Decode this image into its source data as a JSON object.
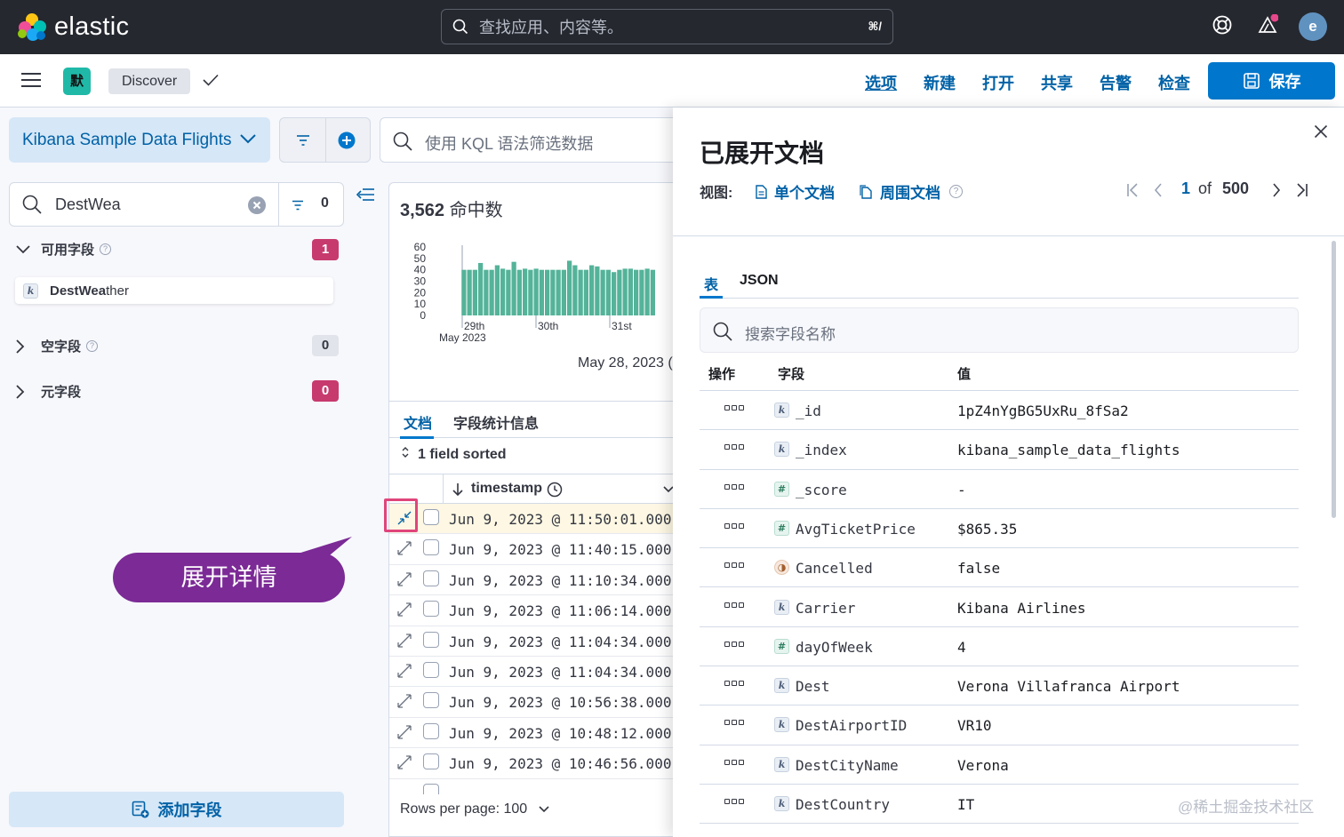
{
  "header": {
    "brand": "elastic",
    "search_placeholder": "查找应用、内容等。",
    "search_shortcut": "⌘/",
    "avatar_initial": "e",
    "icons": [
      "help-icon",
      "notifications-icon"
    ]
  },
  "appbar": {
    "space_initial": "默",
    "breadcrumb": "Discover",
    "links": [
      "选项",
      "新建",
      "打开",
      "共享",
      "告警",
      "检查"
    ],
    "save_label": "保存",
    "accent": "#0077cc"
  },
  "sidebar": {
    "data_view": "Kibana Sample Data Flights",
    "kql_placeholder": "使用 KQL 语法筛选数据",
    "field_search_value": "DestWea",
    "filter_count": "0",
    "sections": [
      {
        "label": "可用字段",
        "count": "1",
        "has_help": true
      },
      {
        "label": "空字段",
        "count": "0",
        "has_help": true
      },
      {
        "label": "元字段",
        "count": "0",
        "has_help": false
      }
    ],
    "field_match": "DestWea",
    "field_rest": "ther",
    "field_type": "k",
    "add_field_label": "添加字段"
  },
  "callout": {
    "text": "展开详情"
  },
  "results": {
    "hits_count": "3,562",
    "hits_label": "命中数",
    "chart_data": {
      "type": "bar",
      "y_ticks": [
        "60",
        "50",
        "40",
        "30",
        "20",
        "10",
        "0"
      ],
      "x_labels": [
        "29th",
        "30th",
        "31st"
      ],
      "x_sub_label": "May 2023",
      "ylim": [
        0,
        60
      ],
      "values": [
        0,
        0,
        0,
        0,
        0,
        40,
        40,
        40,
        46,
        40,
        40,
        44,
        41,
        40,
        47,
        40,
        41,
        40,
        41,
        40,
        40,
        40,
        40,
        40,
        48,
        44,
        40,
        40,
        44,
        43,
        40,
        40,
        38,
        40,
        41,
        41,
        40,
        40,
        41,
        40
      ],
      "date_range_label": "May 28, 2023 ("
    },
    "tabs": [
      "文档",
      "字段统计信息"
    ],
    "sorted_label": "1 field sorted",
    "column_header": "timestamp",
    "rows": [
      "Jun 9, 2023 @ 11:50:01.000",
      "Jun 9, 2023 @ 11:40:15.000",
      "Jun 9, 2023 @ 11:10:34.000",
      "Jun 9, 2023 @ 11:06:14.000",
      "Jun 9, 2023 @ 11:04:34.000",
      "Jun 9, 2023 @ 11:04:34.000",
      "Jun 9, 2023 @ 10:56:38.000",
      "Jun 9, 2023 @ 10:48:12.000",
      "Jun 9, 2023 @ 10:46:56.000"
    ],
    "rows_per_page": "Rows per page: 100"
  },
  "flyout": {
    "title": "已展开文档",
    "view_label": "视图:",
    "view_single": "单个文档",
    "view_surrounding": "周围文档",
    "page_current": "1",
    "page_of": "of",
    "page_total": "500",
    "tabs": [
      "表",
      "JSON"
    ],
    "search_placeholder": "搜索字段名称",
    "headers": [
      "操作",
      "字段",
      "值"
    ],
    "fields": [
      {
        "type": "k",
        "name": "_id",
        "value": "1pZ4nYgBG5UxRu_8fSa2"
      },
      {
        "type": "k",
        "name": "_index",
        "value": "kibana_sample_data_flights"
      },
      {
        "type": "#",
        "name": "_score",
        "value": " -"
      },
      {
        "type": "#",
        "name": "AvgTicketPrice",
        "value": "$865.35"
      },
      {
        "type": "bool",
        "name": "Cancelled",
        "value": "false"
      },
      {
        "type": "k",
        "name": "Carrier",
        "value": "Kibana Airlines"
      },
      {
        "type": "#",
        "name": "dayOfWeek",
        "value": "4"
      },
      {
        "type": "k",
        "name": "Dest",
        "value": "Verona Villafranca Airport"
      },
      {
        "type": "k",
        "name": "DestAirportID",
        "value": "VR10"
      },
      {
        "type": "k",
        "name": "DestCityName",
        "value": "Verona"
      },
      {
        "type": "k",
        "name": "DestCountry",
        "value": "IT"
      }
    ]
  },
  "watermark": "@稀土掘金技术社区"
}
